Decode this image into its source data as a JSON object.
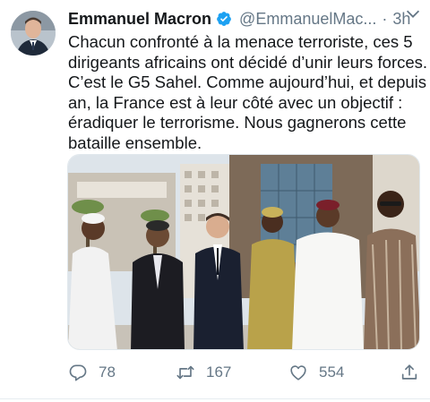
{
  "tweet": {
    "author_name": "Emmanuel Macron",
    "handle": "@EmmanuelMac...",
    "separator": "·",
    "time": "3h",
    "text_lines": [
      "Chacun confronté à la menace terroriste, ces 5",
      "dirigeants africains ont décidé d’unir leurs forces.",
      "C’est le G5 Sahel. Comme aujourd’hui, et depuis un",
      "an, la France est à leur côté avec un objectif :",
      "éradiquer le terrorisme. Nous gagnerons cette",
      "bataille ensemble."
    ],
    "media_alt": "Photo of six leaders standing in front of a building"
  },
  "actions": {
    "replies": "78",
    "retweets": "167",
    "likes": "554"
  },
  "icons": {
    "verified": "verified-badge-icon",
    "caret": "chevron-down-icon",
    "reply": "reply-icon",
    "retweet": "retweet-icon",
    "like": "heart-icon",
    "share": "share-icon"
  },
  "colors": {
    "verified_blue": "#1da1f2",
    "secondary_text": "#657786",
    "primary_text": "#14171a"
  }
}
